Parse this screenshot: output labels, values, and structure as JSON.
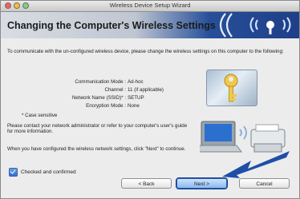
{
  "window": {
    "title": "Wireless Device Setup Wizard"
  },
  "banner": {
    "title": "Changing the Computer's Wireless Settings"
  },
  "intro": "To communicate with the un-configured wireless device, please change the wireless settings on this computer to the following:",
  "settings": [
    {
      "label": "Communication Mode :",
      "value": "Ad-hoc"
    },
    {
      "label": "Channel :",
      "value": "11  (if applicable)"
    },
    {
      "label": "Network Name (SSID)* :",
      "value": "SETUP"
    },
    {
      "label": "Encryption Mode :",
      "value": "None"
    }
  ],
  "case_note": "* Case sensitive",
  "contact_text": "Please contact your network administrator or refer to your computer's user's guide for more information.",
  "configured_text": "When you have configured the wireless network settings, click \"Next\" to continue.",
  "checkbox": {
    "label": "Checked and confirmed",
    "checked": true
  },
  "buttons": {
    "back": "< Back",
    "next": "Next >",
    "cancel": "Cancel"
  },
  "colors": {
    "accent": "#1f3f87",
    "arrow": "#1e4fa8"
  }
}
